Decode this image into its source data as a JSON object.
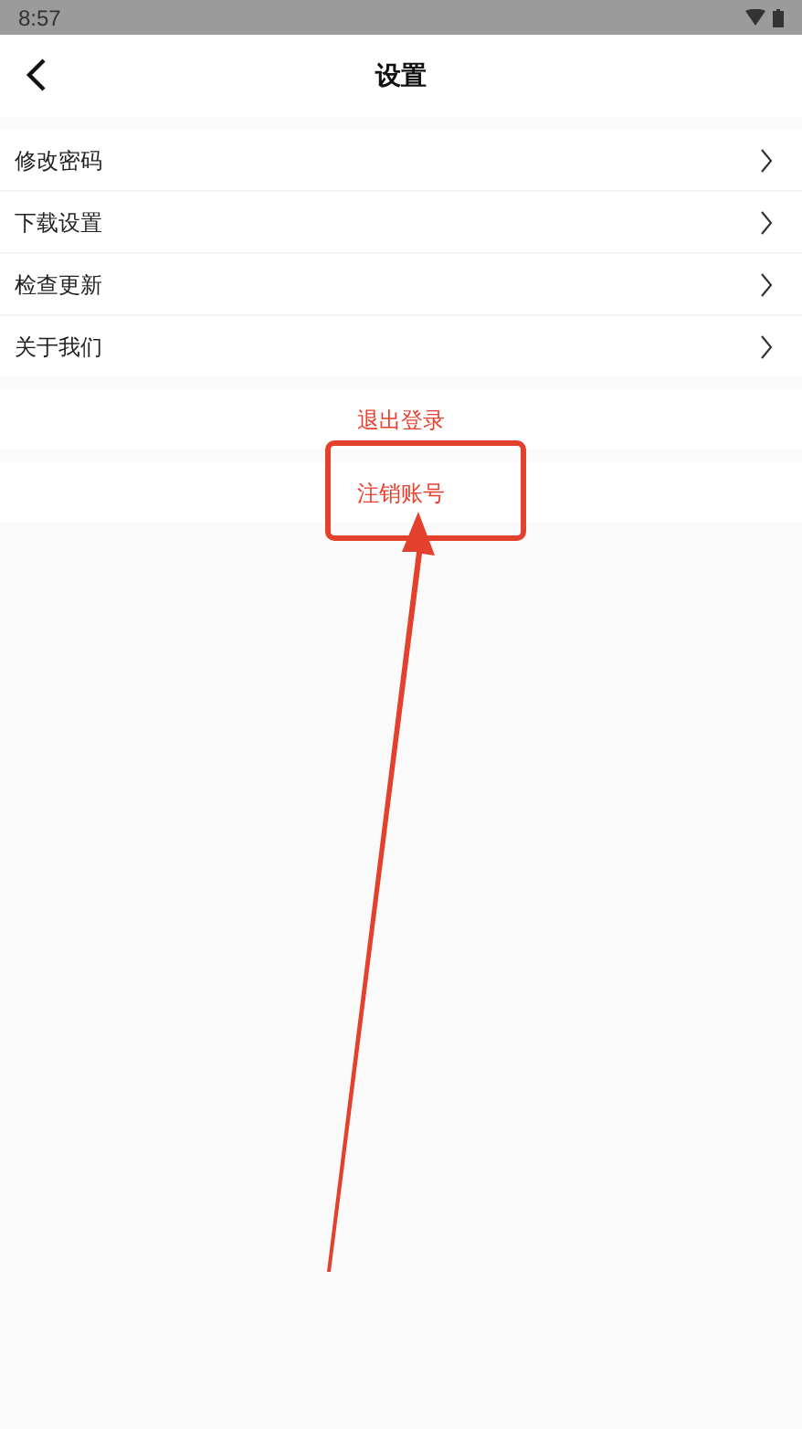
{
  "status_bar": {
    "time": "8:57"
  },
  "header": {
    "title": "设置"
  },
  "menu_items": [
    {
      "label": "修改密码"
    },
    {
      "label": "下载设置"
    },
    {
      "label": "检查更新"
    },
    {
      "label": "关于我们"
    }
  ],
  "actions": [
    {
      "label": "退出登录",
      "kind": "plain"
    },
    {
      "label": "注销账号",
      "kind": "annotated"
    }
  ]
}
